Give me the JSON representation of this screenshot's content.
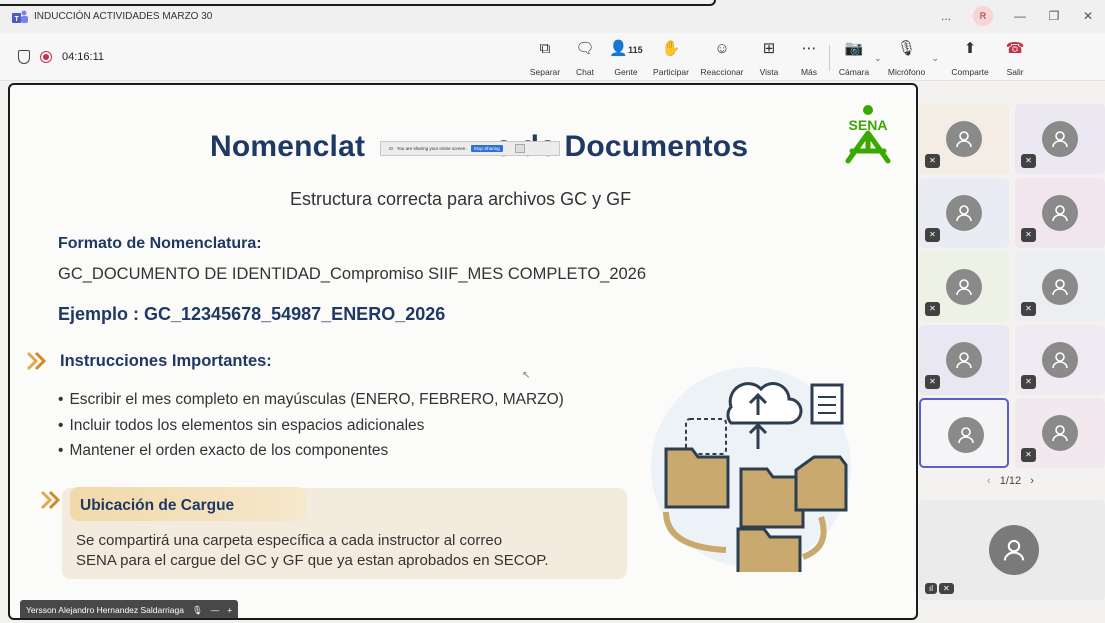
{
  "window": {
    "title": "INDUCCIÓN ACTIVIDADES MARZO 30",
    "more": "...",
    "user_initial": "R"
  },
  "meeting": {
    "timer": "04:16:11",
    "toolbar": {
      "separar": "Separar",
      "chat": "Chat",
      "people_count": "115",
      "gente": "Gente",
      "participar": "Participar",
      "reaccionar": "Reaccionar",
      "vista": "Vista",
      "mas": "Más",
      "camara": "Cámara",
      "microfono": "Micrófono",
      "comparte": "Comparte",
      "salir": "Salir"
    }
  },
  "slide": {
    "title_left": "Nomenclat",
    "title_right": "e de Documentos",
    "subtitle": "Estructura correcta para archivos GC y GF",
    "format_heading": "Formato de Nomenclatura:",
    "format_line": "GC_DOCUMENTO DE IDENTIDAD_Compromiso SIIF_MES COMPLETO_2026",
    "example": "Ejemplo : GC_12345678_54987_ENERO_2026",
    "instructions_heading": "Instrucciones Importantes:",
    "instructions": [
      "Escribir el mes completo en mayúsculas (ENERO, FEBRERO, MARZO)",
      "Incluir todos los elementos sin espacios adicionales",
      "Mantener el orden exacto de los componentes"
    ],
    "cargue_heading": "Ubicación de Cargue",
    "cargue_line1": "Se compartirá una carpeta específica a cada instructor al correo",
    "cargue_line2": "SENA para el cargue del GC y GF que ya estan aprobados en SECOP.",
    "logo_text": "SENA"
  },
  "share_banner": {
    "message": "You are sharing your entire screen.",
    "stop": "Stop Sharing"
  },
  "presenter": {
    "name": "Yersson Alejandro Hernandez Saldarriaga"
  },
  "gallery": {
    "pager": "1/12"
  },
  "colors": {
    "accent": "#1f3864",
    "sena_green": "#39a900",
    "leave_red": "#c4314b"
  }
}
